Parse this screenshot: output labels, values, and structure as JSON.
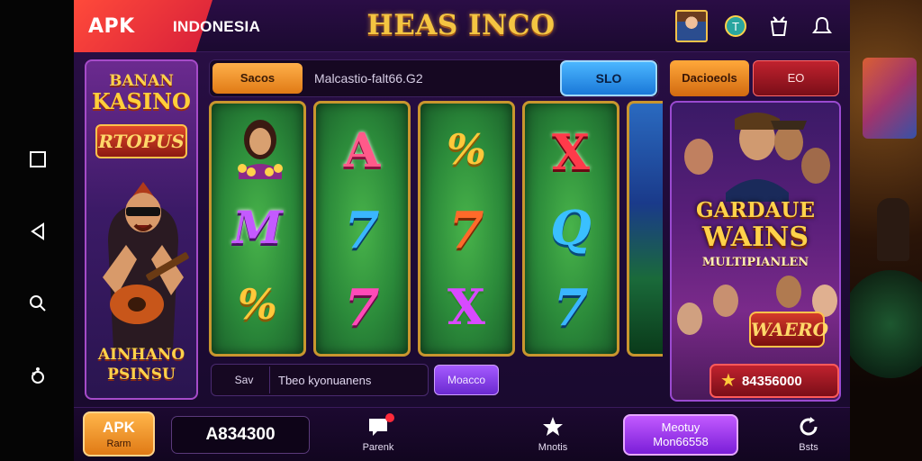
{
  "nav": {
    "icons": [
      "square-icon",
      "back-triangle-icon",
      "search-icon",
      "assistant-icon"
    ]
  },
  "header": {
    "brand": "APK",
    "region": "INDONESIA",
    "title": "HEAS INCO"
  },
  "promo_left": {
    "line1": "BANAN",
    "line2": "KASINO",
    "badge": "RTOPUS",
    "bottom1": "AINHANO",
    "bottom2": "PSINSU"
  },
  "search": {
    "chip": "Sacos",
    "value": "Malcastio-falt66.G2",
    "slot_button": "SLO"
  },
  "reels": [
    [
      "avatar",
      "A",
      "%"
    ],
    [
      "M",
      "7",
      "7"
    ],
    [
      "%",
      "7",
      "X"
    ],
    [
      "X",
      "Q",
      "7"
    ]
  ],
  "bet": {
    "label": "Sav",
    "value": "Tbeo kyonuanens",
    "button": "Moacco"
  },
  "right_panel": {
    "tab1": "Dacioeols",
    "tab2": "EO",
    "title1": "GARDAUE",
    "title2": "WAINS",
    "title3": "MULTIPIANLEN",
    "badge": "WAERO",
    "jackpot": "84356000"
  },
  "bottom": {
    "apk_label": "APK",
    "apk_sub": "Rarm",
    "balance": "A834300",
    "nav1": "Parenk",
    "nav2": "Mnotis",
    "promo_line1": "Meotuy",
    "promo_line2": "Mon66558",
    "nav3": "Bsts"
  },
  "colors": {
    "accent_gold": "#f4c542",
    "brand_red": "#e0283a",
    "panel_purple": "#2b0f47",
    "reel_green": "#2b8a3a"
  }
}
